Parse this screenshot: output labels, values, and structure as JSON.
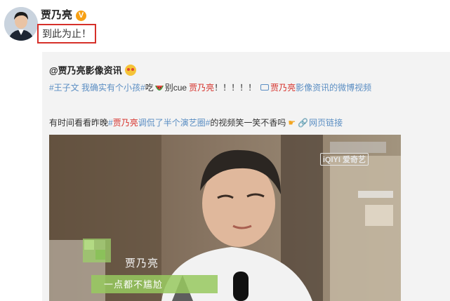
{
  "post": {
    "author": "贾乃亮",
    "verified_badge": "V",
    "text": "到此为止！"
  },
  "repost": {
    "author": "@贾乃亮影像资讯",
    "line1": {
      "topic": "#王子文 我确实有个小孩#",
      "eat": "吃",
      "dont_cue": "别cue",
      "name": "贾乃亮",
      "exclaim": "！！！！！",
      "video_prefix": "贾乃亮",
      "video_suffix": "影像资讯的微博视频"
    },
    "line2": {
      "prefix": "有时间看看昨晚",
      "topic_hash": "#",
      "topic_name": "贾乃亮",
      "topic_rest": "调侃了半个演艺圈#",
      "suffix": " 的视频笑一笑不香吗",
      "link_label": "网页链接"
    }
  },
  "video": {
    "watermark": "iQIYI 爱奇艺",
    "caption_name": "贾乃亮",
    "caption_line": "一点都不尴尬"
  },
  "colors": {
    "link_blue": "#5b8ec3",
    "highlight_red": "#d6302a",
    "verified_orange": "#f7a014",
    "repost_bg": "#f3f3f3"
  },
  "icons": [
    "avatar",
    "verified-badge-icon",
    "heart-eyes-emoji-icon",
    "watermelon-icon",
    "video-icon",
    "pointing-hand-icon",
    "link-icon"
  ]
}
